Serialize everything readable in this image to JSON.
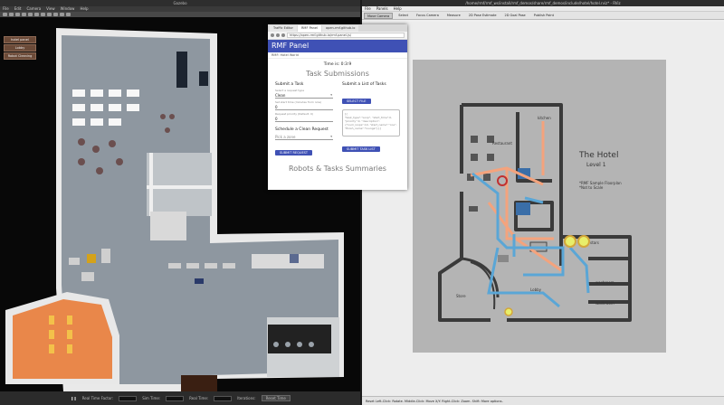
{
  "gazebo": {
    "title": "Gazebo",
    "menu": [
      "File",
      "Edit",
      "Camera",
      "View",
      "Window",
      "Help"
    ],
    "side_buttons": [
      "hotel panel",
      "Lobby",
      "Robot Cleaning"
    ],
    "status": {
      "real_time_factor_label": "Real Time Factor:",
      "sim_time_label": "Sim Time:",
      "real_time_label": "Real Time:",
      "iterations_label": "Iterations:",
      "reset_label": "Reset Time"
    }
  },
  "browser": {
    "tabs": [
      "Traffic Editor",
      "RMF Panel",
      "open-rmf.github.io"
    ],
    "url": "https://open-rmf.github.io/rmf-panel-js/"
  },
  "rmf_panel": {
    "title": "RMF Panel",
    "world": "RMF: Hotel World",
    "time": "Time is: 0:3:9",
    "task_heading": "Task Submissions",
    "submit_task": {
      "title": "Submit a Task",
      "type_label": "Select a request type",
      "type_value": "Clean",
      "delay_label": "Set start time (minutes from now)",
      "delay_value": "0",
      "priority_label": "Request priority (Default: 0)",
      "priority_value": "0"
    },
    "submit_list": {
      "title": "Submit a List of Tasks",
      "select_file": "SELECT FILE",
      "placeholder": "[{\n\"task_type\":\"Loop\", \"start_time\":0,\n\"priority\":0, \"description\":\n{\"num_loops\":10, \"start_name\":\"coe\",\n\"finish_name\":\"lounge\"}}]",
      "submit": "SUBMIT TASK LIST"
    },
    "clean": {
      "title": "Schedule a Clean Request",
      "zone_placeholder": "Pick a zone",
      "submit": "SUBMIT REQUEST"
    },
    "summary_heading": "Robots & Tasks Summaries"
  },
  "rviz": {
    "title": "/home/rmf/rmf_ws/install/rmf_demos/share/rmf_demos/include/hotel/hotel.rviz* - RViz",
    "menu": [
      "File",
      "Panels",
      "Help"
    ],
    "tools": [
      "Move Camera",
      "Select",
      "Focus Camera",
      "Measure",
      "2D Pose Estimate",
      "2D Goal Pose",
      "Publish Point"
    ],
    "map": {
      "hotel_title": "The Hotel",
      "level": "Level 1",
      "note": "*RMF Sample Floorplan\n*Not to Scale",
      "rooms": [
        "kitchen",
        "Restaurant",
        "Store",
        "Lobby",
        "stars",
        "washroom",
        "washroom"
      ]
    },
    "status": "Reset   Left-Click: Rotate. Middle-Click: Move X/Y. Right-Click: Zoom. Shift: More options."
  },
  "colors": {
    "rmf_primary": "#3f51b5",
    "lane_orange": "#f4a37d",
    "lane_blue": "#5aa6d6"
  }
}
